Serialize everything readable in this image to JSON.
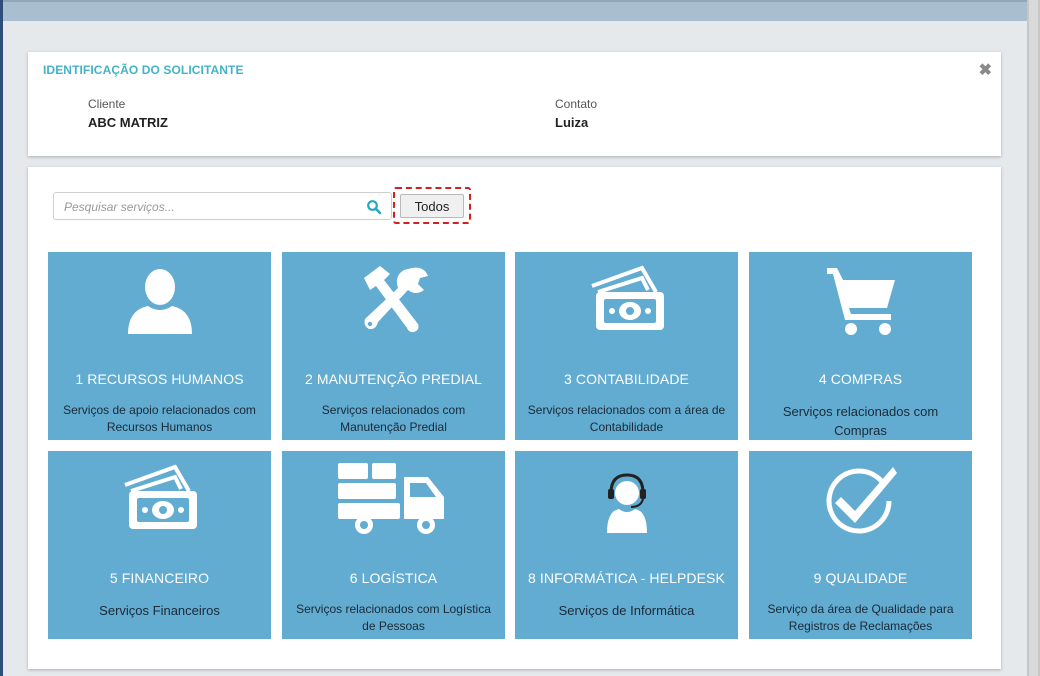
{
  "identification": {
    "title": "IDENTIFICAÇÃO DO SOLICITANTE",
    "close_icon": "✖",
    "client_label": "Cliente",
    "client_value": "ABC MATRIZ",
    "contact_label": "Contato",
    "contact_value": "Luiza"
  },
  "search": {
    "placeholder": "Pesquisar serviços...",
    "value": "",
    "icon": "search-icon"
  },
  "filter": {
    "todos_label": "Todos"
  },
  "colors": {
    "accent": "#44b3c7",
    "tile": "#62abd1",
    "highlight": "#d0201f"
  },
  "services": [
    {
      "name": "1 RECURSOS HUMANOS",
      "desc": "Serviços de apoio relacionados com Recursos Humanos",
      "icon": "user-icon"
    },
    {
      "name": "2 MANUTENÇÃO PREDIAL",
      "desc": "Serviços relacionados com Manutenção Predial",
      "icon": "tools-icon"
    },
    {
      "name": "3 CONTABILIDADE",
      "desc": "Serviços relacionados com a área de Contabilidade",
      "icon": "money-icon"
    },
    {
      "name": "4 COMPRAS",
      "desc": "Serviços relacionados com Compras",
      "icon": "cart-icon"
    },
    {
      "name": "5 FINANCEIRO",
      "desc": "Serviços Financeiros",
      "icon": "money-icon"
    },
    {
      "name": "6 LOGÍSTICA",
      "desc": "Serviços relacionados com Logística de Pessoas",
      "icon": "truck-icon"
    },
    {
      "name": "8 INFORMÁTICA - HELPDESK",
      "desc": "Serviços de Informática",
      "icon": "headset-icon"
    },
    {
      "name": "9 QUALIDADE",
      "desc": "Serviço da área de Qualidade para Registros de Reclamações",
      "icon": "checkmark-icon"
    }
  ]
}
